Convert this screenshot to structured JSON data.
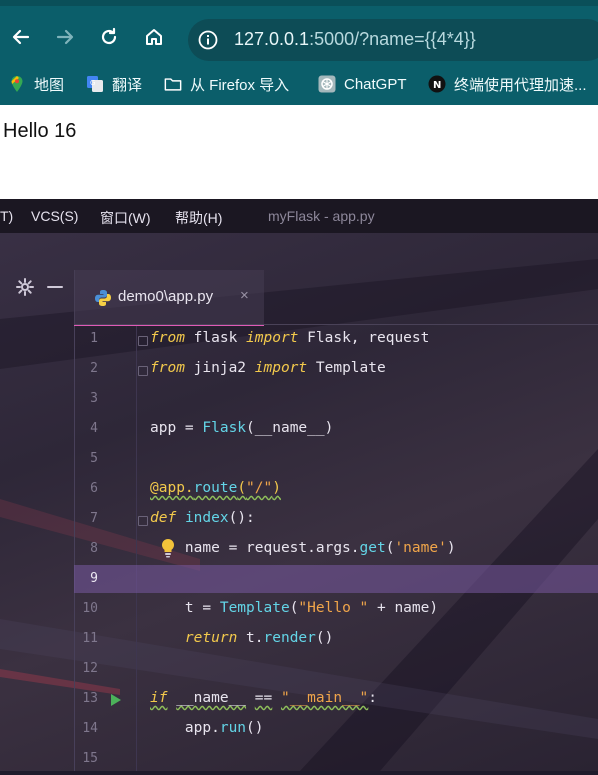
{
  "browser": {
    "url_host": "127.0.0.1",
    "url_rest": ":5000/?name={{4*4}}",
    "icons": [
      "back-icon",
      "forward-icon",
      "reload-icon",
      "home-icon",
      "site-info-icon"
    ]
  },
  "bookmarks": [
    {
      "label": "地图",
      "icon": "maps-icon"
    },
    {
      "label": "翻译",
      "icon": "translate-icon"
    },
    {
      "label": "从 Firefox 导入",
      "icon": "folder-icon"
    },
    {
      "label": "ChatGPT",
      "icon": "chatgpt-icon"
    },
    {
      "label": "终端使用代理加速...",
      "icon": "notion-icon"
    }
  ],
  "page": {
    "text": "Hello 16"
  },
  "ide": {
    "menus": [
      "T)",
      "VCS(S)",
      "窗口(W)",
      "帮助(H)"
    ],
    "project_title": "myFlask - app.py",
    "tab_label": "demo0\\app.py",
    "tab_close": "×",
    "line_numbers": [
      "1",
      "2",
      "3",
      "4",
      "5",
      "6",
      "7",
      "8",
      "9",
      "10",
      "11",
      "12",
      "13",
      "14",
      "15"
    ],
    "active_line": "9"
  },
  "colors": {
    "browser_bar": "#0b5e6a",
    "tab_underline": "#e05ab6",
    "keyword": "#f2c94c",
    "function": "#63d4e6",
    "string": "#f0a54a"
  }
}
